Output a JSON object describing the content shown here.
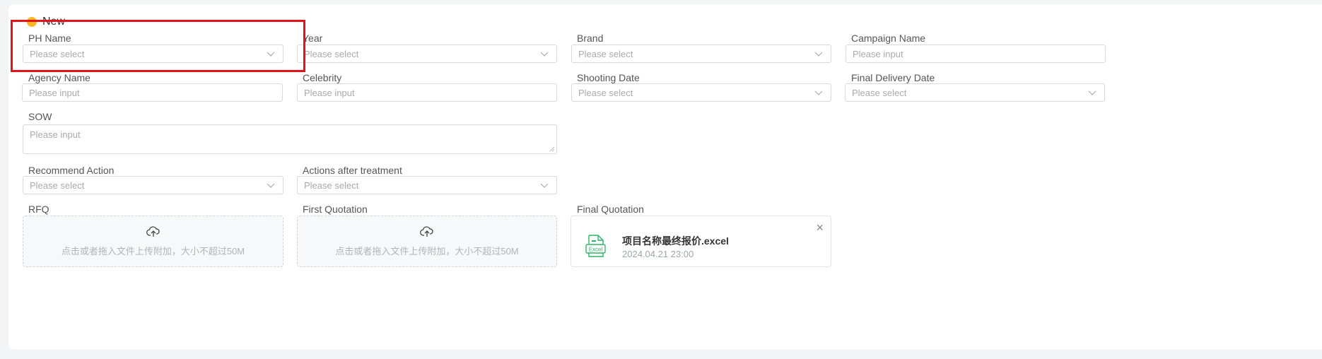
{
  "header": {
    "title": "New"
  },
  "fields": {
    "ph_name": {
      "label": "PH Name",
      "placeholder": "Please select"
    },
    "year": {
      "label": "Year",
      "placeholder": "Please select"
    },
    "brand": {
      "label": "Brand",
      "placeholder": "Please select"
    },
    "campaign_name": {
      "label": "Campaign Name",
      "placeholder": "Please input"
    },
    "agency_name": {
      "label": "Agency Name",
      "placeholder": "Please input"
    },
    "celebrity": {
      "label": "Celebrity",
      "placeholder": "Please input"
    },
    "shooting_date": {
      "label": "Shooting Date",
      "placeholder": "Please select"
    },
    "final_delivery_date": {
      "label": "Final Delivery Date",
      "placeholder": "Please select"
    },
    "sow": {
      "label": "SOW",
      "placeholder": "Please input"
    },
    "recommend_action": {
      "label": "Recommend Action",
      "placeholder": "Please select"
    },
    "actions_after_treatment": {
      "label": "Actions after treatment",
      "placeholder": "Please select"
    }
  },
  "uploads": {
    "rfq": {
      "label": "RFQ",
      "hint": "点击或者拖入文件上传附加，大小不超过50M"
    },
    "first_quotation": {
      "label": "First Quotation",
      "hint": "点击或者拖入文件上传附加，大小不超过50M"
    },
    "final_quotation": {
      "label": "Final Quotation",
      "file_name": "项目名称最终报价.excel",
      "file_date": "2024.04.21 23:00",
      "file_icon_text": "Excel"
    }
  },
  "colors": {
    "accent": "#f7b924",
    "highlight": "#e5121a",
    "excel_green": "#2fb36a"
  }
}
